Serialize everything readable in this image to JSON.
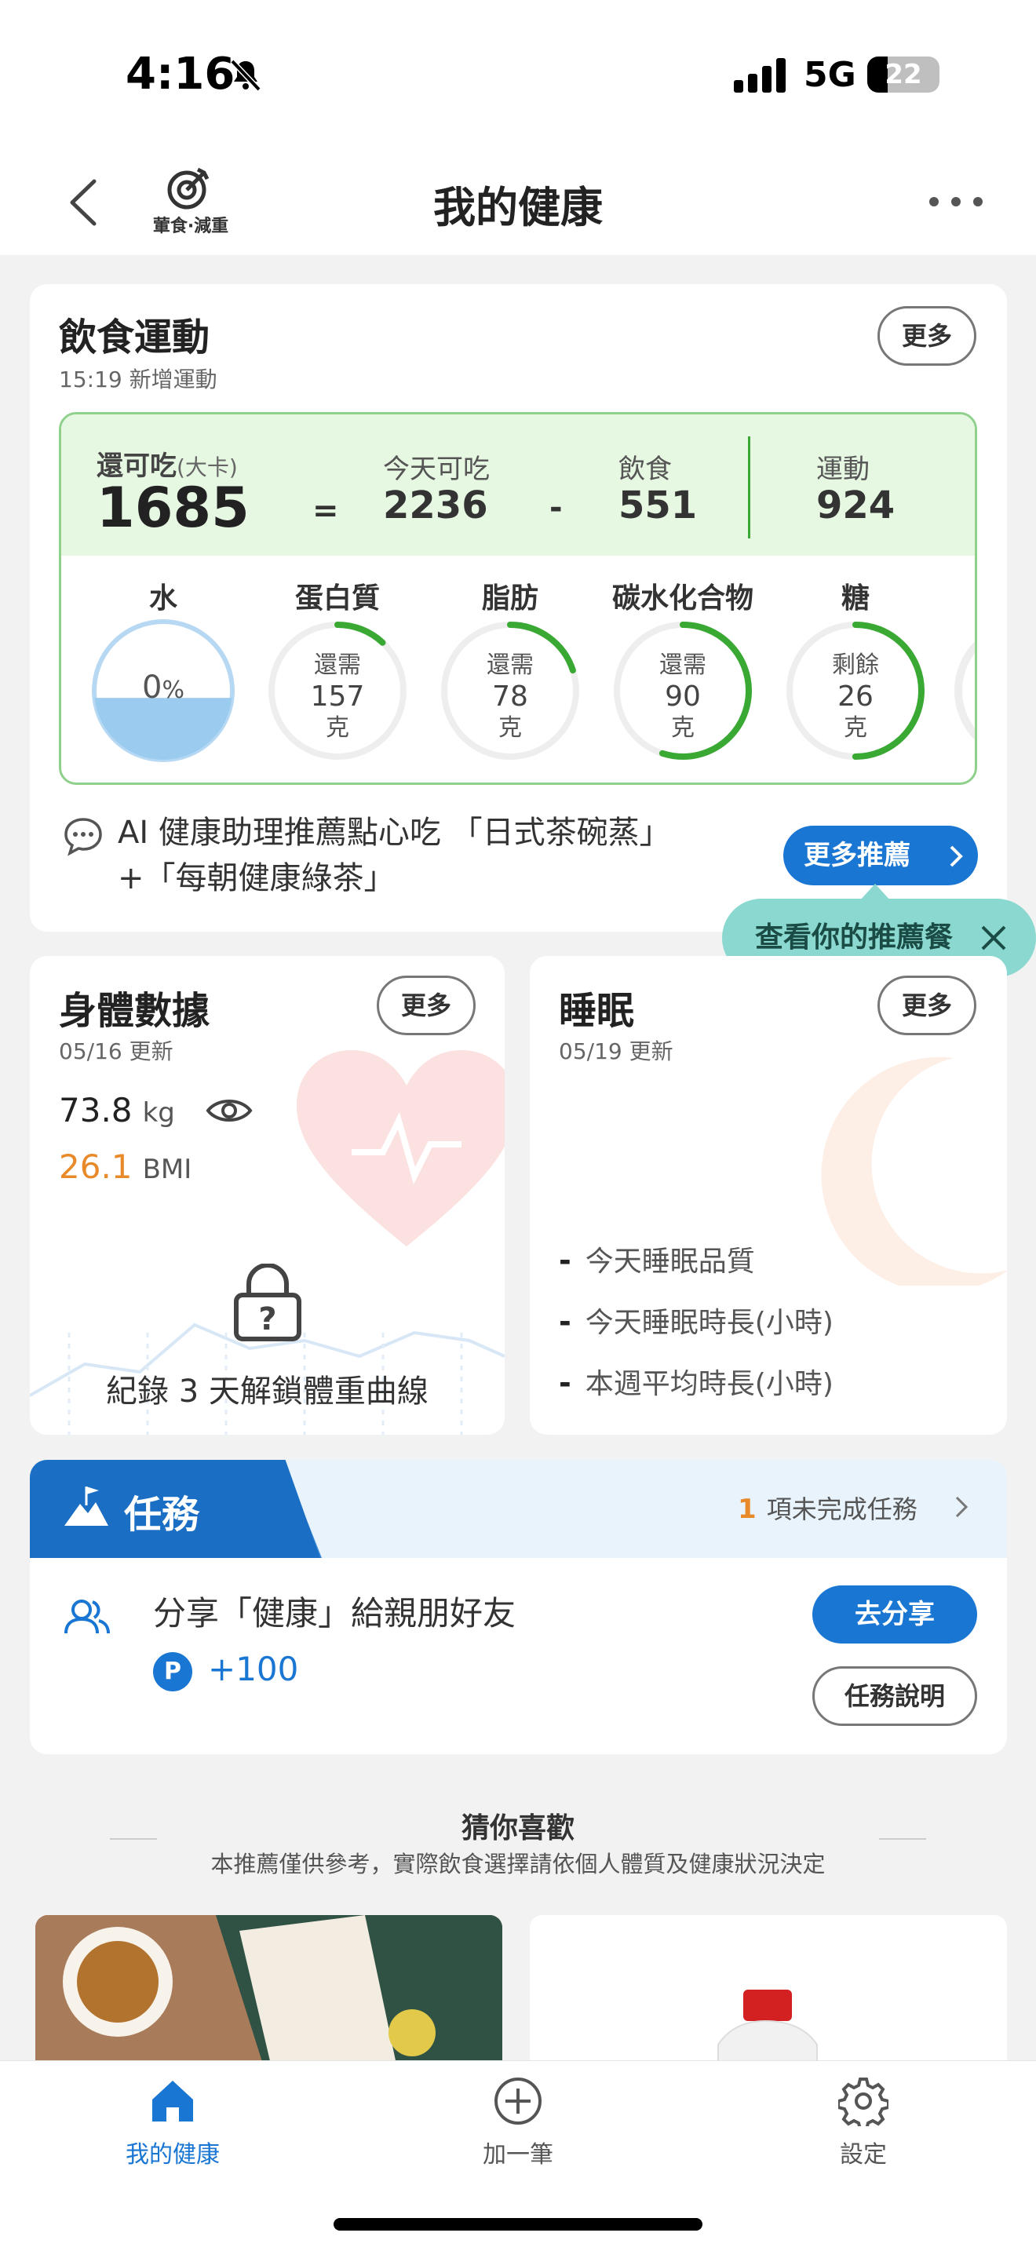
{
  "status_bar": {
    "time": "4:16",
    "network": "5G",
    "battery": "22"
  },
  "header": {
    "goal_label": "葷食·減重",
    "title": "我的健康"
  },
  "diet": {
    "title": "飲食運動",
    "subtitle": "15:19 新增運動",
    "more_label": "更多",
    "remaining_label": "還可吃",
    "remaining_unit": "(大卡)",
    "remaining_value": "1685",
    "eq": "=",
    "minus": "-",
    "today_label": "今天可吃",
    "today_value": "2236",
    "food_label": "飲食",
    "food_value": "551",
    "exercise_label": "運動",
    "exercise_value": "924",
    "water": {
      "title": "水",
      "percent_number": "0",
      "percent_sign": "%",
      "level": 0.45
    },
    "nutrients": [
      {
        "title": "蛋白質",
        "status": "還需",
        "value": "157",
        "unit": "克",
        "progress": 0.12
      },
      {
        "title": "脂肪",
        "status": "還需",
        "value": "78",
        "unit": "克",
        "progress": 0.2
      },
      {
        "title": "碳水化合物",
        "status": "還需",
        "value": "90",
        "unit": "克",
        "progress": 0.55
      },
      {
        "title": "糖",
        "status": "剩餘",
        "value": "26",
        "unit": "克",
        "progress": 0.5
      }
    ],
    "ai_text": "AI 健康助理推薦點心吃 「日式茶碗蒸」+「每朝健康綠茶」",
    "more_rec_label": "更多推薦",
    "tooltip": "查看你的推薦餐"
  },
  "body_data": {
    "title": "身體數據",
    "subtitle": "05/16 更新",
    "more_label": "更多",
    "weight": "73.8",
    "weight_unit": "kg",
    "bmi": "26.1",
    "bmi_label": "BMI",
    "lock_text": "紀錄 3 天解鎖體重曲線"
  },
  "sleep": {
    "title": "睡眠",
    "subtitle": "05/19 更新",
    "more_label": "更多",
    "items": [
      {
        "dash": "-",
        "label": "今天睡眠品質"
      },
      {
        "dash": "-",
        "label": "今天睡眠時長(小時)"
      },
      {
        "dash": "-",
        "label": "本週平均時長(小時)"
      }
    ]
  },
  "tasks": {
    "title": "任務",
    "pending_count": "1",
    "pending_label": "項未完成任務",
    "task_title": "分享「健康」給親朋好友",
    "points_badge": "P",
    "points": "+100",
    "share_label": "去分享",
    "explain_label": "任務說明"
  },
  "recommend": {
    "title": "猜你喜歡",
    "disclaimer": "本推薦僅供參考，實際飲食選擇請依個人體質及健康狀況決定"
  },
  "nav": {
    "home": "我的健康",
    "add": "加一筆",
    "settings": "設定"
  },
  "colors": {
    "primary": "#1976d2",
    "green_ring": "#3aa934",
    "water": "#9ccbf0",
    "bmi_orange": "#e8892a"
  }
}
